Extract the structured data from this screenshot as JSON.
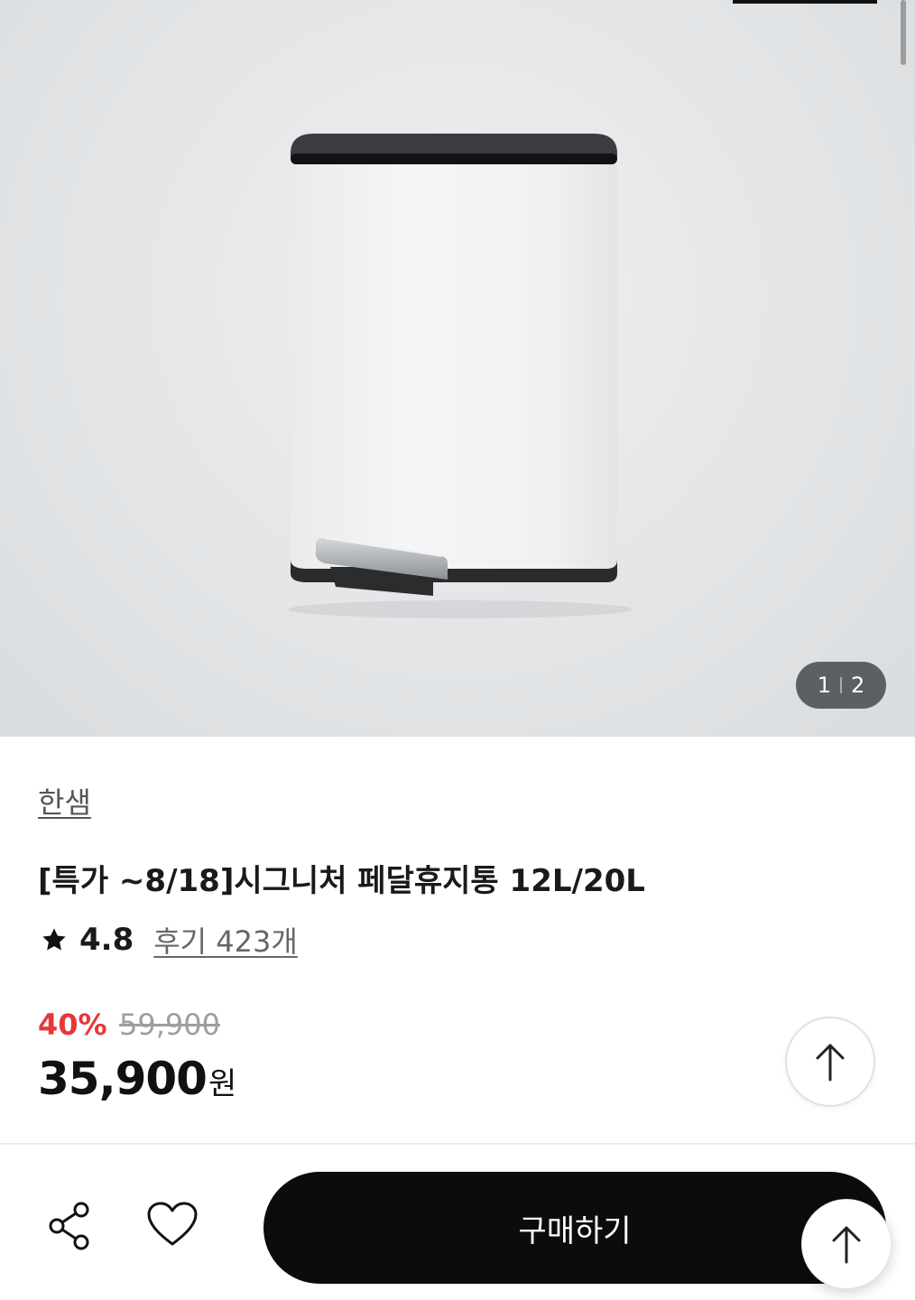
{
  "gallery": {
    "current": "1",
    "total": "2",
    "image_alt": "white pedal trash bin"
  },
  "product": {
    "brand": "한샘",
    "title": "[특가 ~8/18]시그니처 페달휴지통 12L/20L",
    "rating": "4.8",
    "reviews": "후기 423개",
    "discount": "40%",
    "original_price": "59,900",
    "price": "35,900",
    "currency": "원"
  },
  "actions": {
    "buy_label": "구매하기",
    "share_icon": "share-icon",
    "wishlist_icon": "heart-icon",
    "scroll_top_icon": "arrow-up-icon"
  },
  "colors": {
    "discount": "#e8373b",
    "buy_button": "#0c0c0c"
  }
}
